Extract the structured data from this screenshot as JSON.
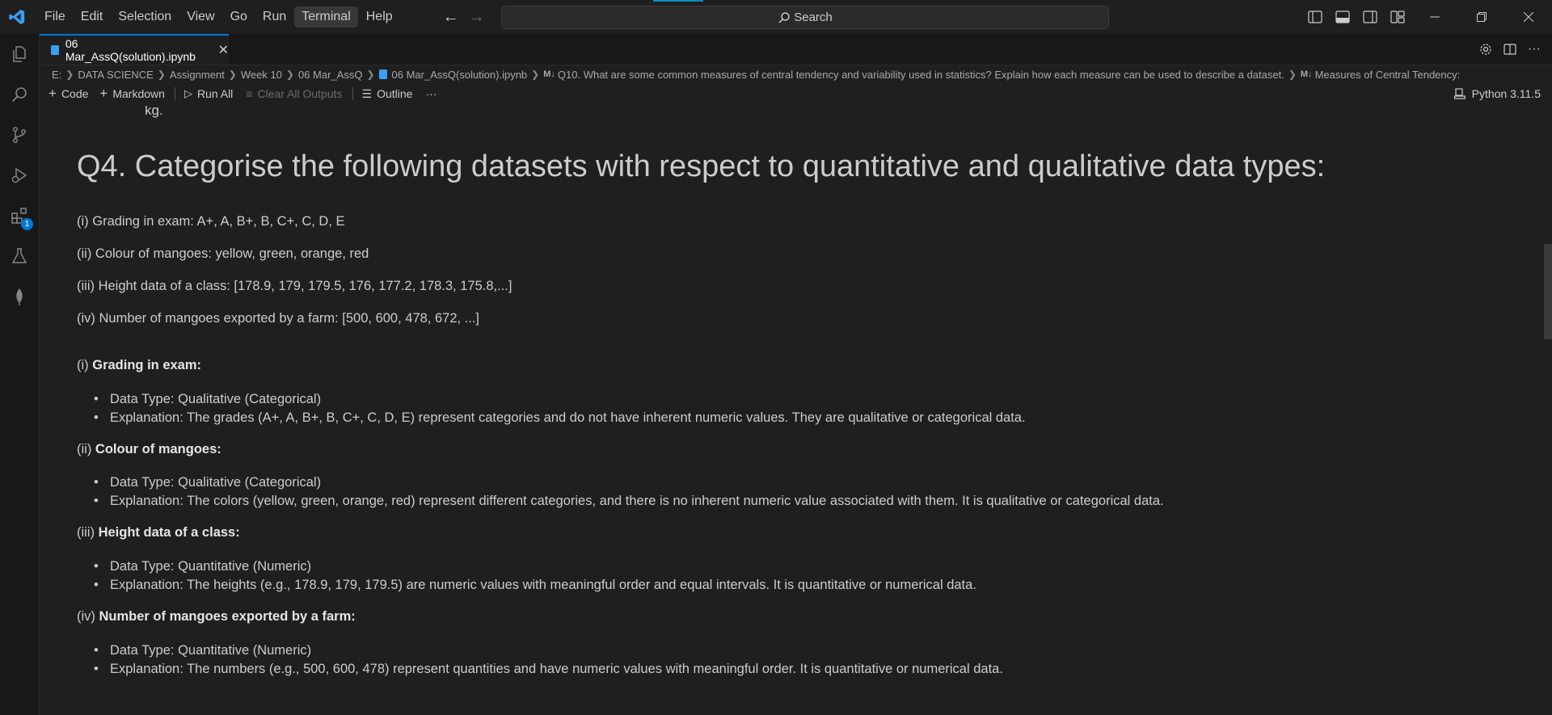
{
  "menu": [
    "File",
    "Edit",
    "Selection",
    "View",
    "Go",
    "Run",
    "Terminal",
    "Help"
  ],
  "search": {
    "label": "Search"
  },
  "tab": {
    "title": "06 Mar_AssQ(solution).ipynb"
  },
  "breadcrumb": {
    "parts": [
      "E:",
      "DATA SCIENCE",
      "Assignment",
      "Week 10",
      "06 Mar_AssQ",
      "06 Mar_AssQ(solution).ipynb",
      "Q10. What are some common measures of central tendency and variability used in statistics? Explain how each measure can be used to describe a dataset.",
      "Measures of Central Tendency:"
    ]
  },
  "toolbar": {
    "code": "Code",
    "markdown": "Markdown",
    "run_all": "Run All",
    "clear": "Clear All Outputs",
    "outline": "Outline",
    "more": "···",
    "kernel": "Python 3.11.5"
  },
  "extensions_badge": "1",
  "content": {
    "fragment": "kg.",
    "title": "Q4. Categorise the following datasets with respect to quantitative and qualitative data types:",
    "items": [
      "(i) Grading in exam: A+, A, B+, B, C+, C, D, E",
      "(ii) Colour of mangoes: yellow, green, orange, red",
      "(iii) Height data of a class: [178.9, 179, 179.5, 176, 177.2, 178.3, 175.8,...]",
      "(iv) Number of mangoes exported by a farm: [500, 600, 478, 672, ...]"
    ],
    "sections": [
      {
        "prefix": "(i)",
        "heading": "Grading in exam:",
        "type": "Data Type: Qualitative (Categorical)",
        "explanation": "Explanation: The grades (A+, A, B+, B, C+, C, D, E) represent categories and do not have inherent numeric values. They are qualitative or categorical data."
      },
      {
        "prefix": "(ii)",
        "heading": "Colour of mangoes:",
        "type": "Data Type: Qualitative (Categorical)",
        "explanation": "Explanation: The colors (yellow, green, orange, red) represent different categories, and there is no inherent numeric value associated with them. It is qualitative or categorical data."
      },
      {
        "prefix": "(iii)",
        "heading": "Height data of a class:",
        "type": "Data Type: Quantitative (Numeric)",
        "explanation": "Explanation: The heights (e.g., 178.9, 179, 179.5) are numeric values with meaningful order and equal intervals. It is quantitative or numerical data."
      },
      {
        "prefix": "(iv)",
        "heading": "Number of mangoes exported by a farm:",
        "type": "Data Type: Quantitative (Numeric)",
        "explanation": "Explanation: The numbers (e.g., 500, 600, 478) represent quantities and have numeric values with meaningful order. It is quantitative or numerical data."
      }
    ]
  }
}
